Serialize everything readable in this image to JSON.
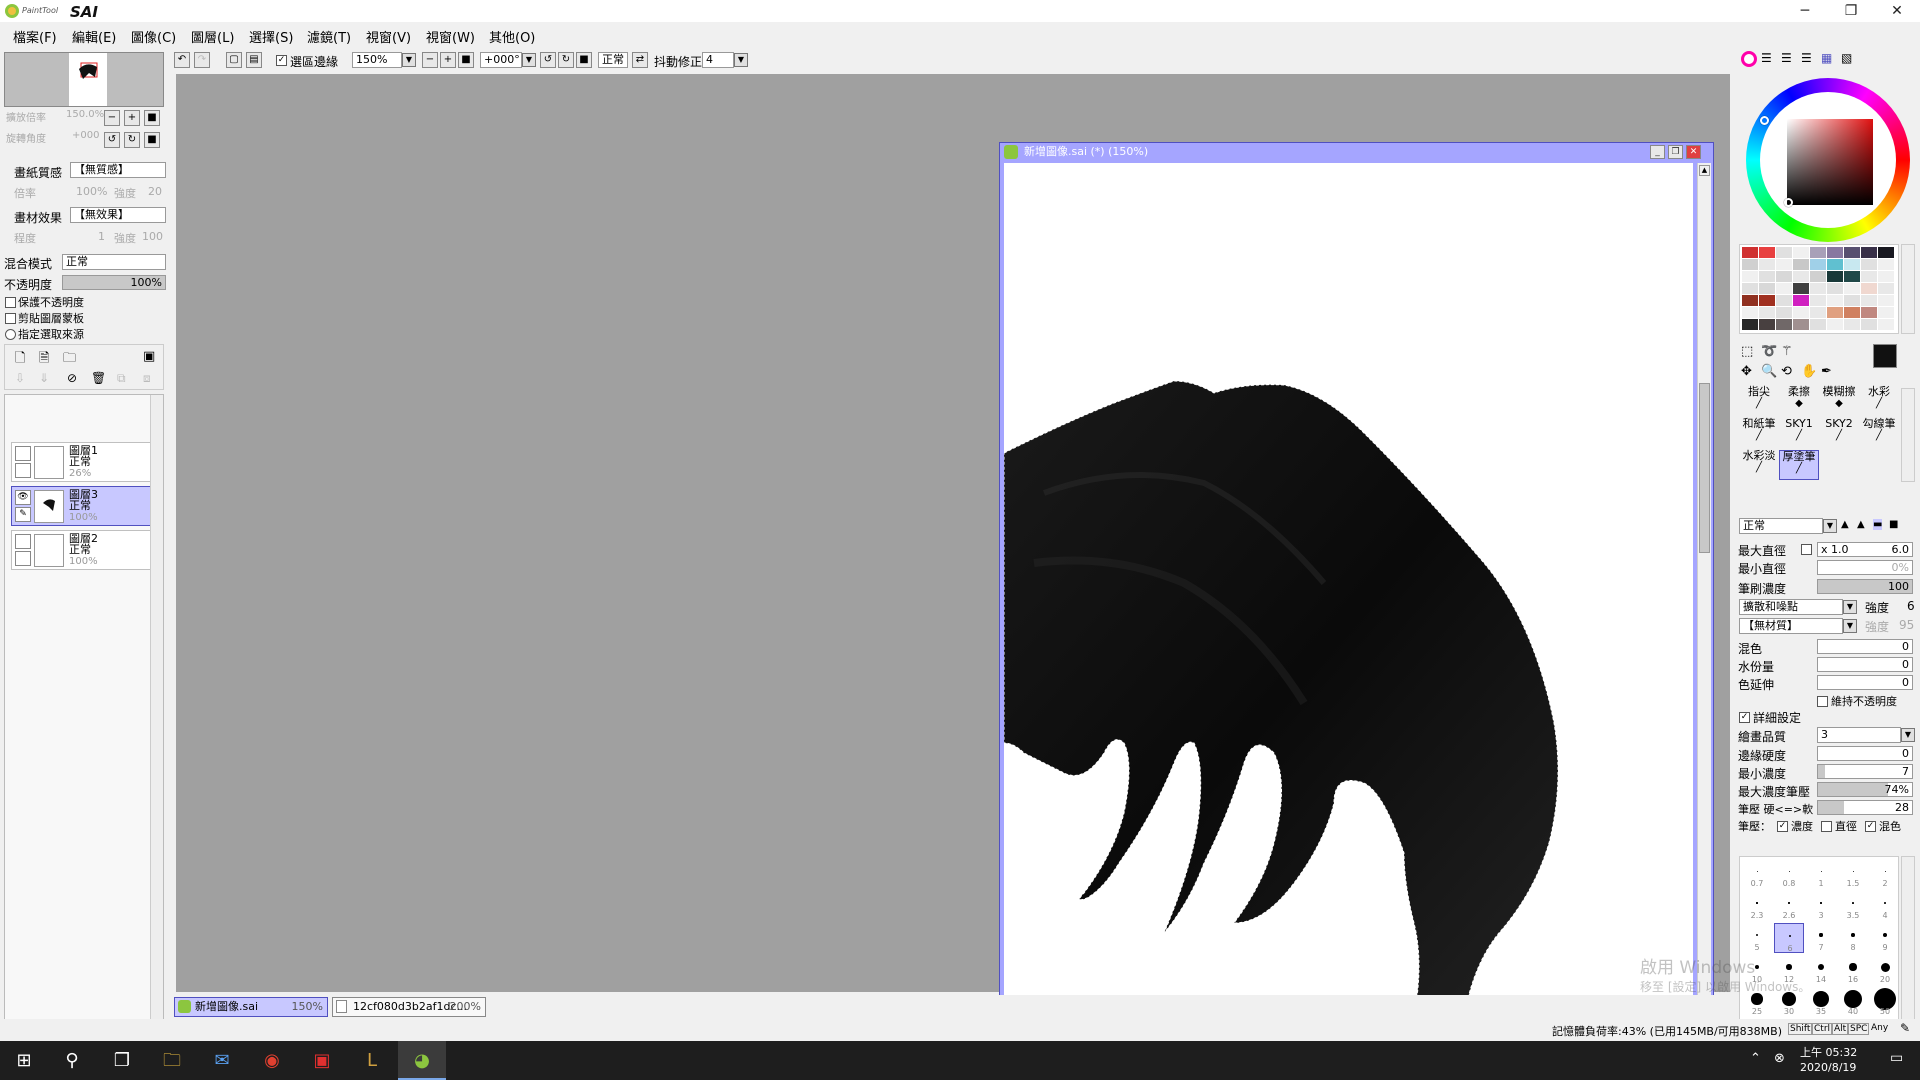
{
  "app": {
    "logo_text": "PaintTool SAI",
    "window_controls": [
      "─",
      "❐",
      "✕"
    ]
  },
  "menu": [
    "檔案(F)",
    "編輯(E)",
    "圖像(C)",
    "圖層(L)",
    "選擇(S)",
    "濾鏡(T)",
    "視窗(V)",
    "視窗(W)",
    "其他(O)"
  ],
  "navigator": {
    "zoom_label": "擴放倍率",
    "zoom_value": "150.0%",
    "rotate_label": "旋轉角度",
    "rotate_value": "+000"
  },
  "paper": {
    "texture_label": "畫紙質感",
    "texture_value": "【無質感】",
    "ratio_label": "倍率",
    "ratio_value": "100%",
    "strength_label": "強度",
    "strength_value": "20",
    "effect_label": "畫材效果",
    "effect_value": "【無效果】",
    "degree_label": "程度",
    "degree_value": "1",
    "effect_strength_label": "強度",
    "effect_strength_value": "100"
  },
  "layer_props": {
    "blend_label": "混合模式",
    "blend_value": "正常",
    "opacity_label": "不透明度",
    "opacity_value": "100%",
    "opacity_fraction": 1.0,
    "preserve_opacity": "保護不透明度",
    "clip_group": "剪貼圖層蒙板",
    "selection_source": "指定選取來源"
  },
  "layers": [
    {
      "name": "圖層1",
      "mode": "正常",
      "opacity": "26%",
      "selected": false,
      "visible": false
    },
    {
      "name": "圖層3",
      "mode": "正常",
      "opacity": "100%",
      "selected": true,
      "visible": true
    },
    {
      "name": "圖層2",
      "mode": "正常",
      "opacity": "100%",
      "selected": false,
      "visible": false
    }
  ],
  "toolbar": {
    "antialias_label": "選區邊緣",
    "zoom_value": "150%",
    "angle_value": "+000°",
    "blend_value": "正常",
    "stabilizer_label": "抖動修正",
    "stabilizer_value": "4"
  },
  "canvas_window": {
    "title": "新增圖像.sai (*) (150%)"
  },
  "doc_tabs": [
    {
      "name": "新增圖像.sai",
      "zoom": "150%",
      "active": true
    },
    {
      "name": "12cf080d3b2af1dc...",
      "zoom": "200%",
      "active": false
    }
  ],
  "palette_colors": [
    "#d03030",
    "#e84040",
    "#e0e0e0",
    "#f0f0f0",
    "#a8a0b8",
    "#8878a0",
    "#585070",
    "#383048",
    "#181820",
    "#d0d0d0",
    "#e8e8e8",
    "#f0f0f0",
    "#c8c8c8",
    "#a0d0e8",
    "#60c0d0",
    "#c8e8f0",
    "#e0e0e0",
    "#f0f0f0",
    "#f0f0f0",
    "#e0e0e0",
    "#d8d8d8",
    "#e8e8e8",
    "#d0d0d0",
    "#183838",
    "#204848",
    "#e8e8e8",
    "#f0f0f0",
    "#e0e0e0",
    "#d8d8d8",
    "#f0f0f0",
    "#404040",
    "#e8e8e8",
    "#e0e0e0",
    "#f0f0f0",
    "#f0d8d0",
    "#e8e8e8",
    "#903020",
    "#a03020",
    "#e0e0e0",
    "#d020c0",
    "#e8e8e8",
    "#f0f0f0",
    "#e0e0e0",
    "#e8e8e8",
    "#f0f0f0",
    "#f0f0f0",
    "#e8e8e8",
    "#e0e0e0",
    "#f0f0f0",
    "#e8e8e8",
    "#e0a080",
    "#d08060",
    "#c08880",
    "#f0f0f0",
    "#282828",
    "#484040",
    "#706868",
    "#a09090",
    "#e0e0e0",
    "#f0f0f0",
    "#e8e8e8",
    "#e0e0e0",
    "#f0f0f0"
  ],
  "brushes": [
    {
      "name": "指尖",
      "selected": false
    },
    {
      "name": "柔擦",
      "selected": false
    },
    {
      "name": "模糊擦",
      "selected": false
    },
    {
      "name": "水彩",
      "selected": false
    },
    {
      "name": "和紙筆",
      "selected": false
    },
    {
      "name": "SKY1",
      "selected": false
    },
    {
      "name": "SKY2",
      "selected": false
    },
    {
      "name": "勾線筆",
      "selected": false
    },
    {
      "name": "水彩淡",
      "selected": false
    },
    {
      "name": "厚塗筆",
      "selected": true
    }
  ],
  "brush_settings": {
    "mode": "正常",
    "max_size_label": "最大直徑",
    "max_size_mult": "x 1.0",
    "max_size_value": "6.0",
    "min_size_label": "最小直徑",
    "min_size_value": "0%",
    "density_label": "筆刷濃度",
    "density_value": "100",
    "density_fraction": 1.0,
    "shape_value": "擴散和噪點",
    "shape_strength_label": "強度",
    "shape_strength_value": "6",
    "texture_value": "【無材質】",
    "texture_strength_label": "強度",
    "texture_strength_value": "95",
    "blend_label": "混色",
    "blend_value": "0",
    "water_label": "水份量",
    "water_value": "0",
    "persist_label": "色延伸",
    "persist_value": "0",
    "keep_opacity_label": "維持不透明度",
    "advanced_label": "詳細設定",
    "quality_label": "繪畫品質",
    "quality_value": "3",
    "edge_label": "邊緣硬度",
    "edge_value": "0",
    "min_density_label": "最小濃度",
    "min_density_value": "7",
    "min_density_fraction": 0.07,
    "max_pressure_label": "最大濃度筆壓",
    "max_pressure_value": "74%",
    "max_pressure_fraction": 0.74,
    "hardsoft_label": "筆壓 硬<=>軟",
    "hardsoft_value": "28",
    "hardsoft_fraction": 0.28,
    "pressure_label": "筆壓：",
    "pressure_density": "濃度",
    "pressure_size": "直徑",
    "pressure_blend": "混色"
  },
  "brush_sizes": [
    "0.7",
    "0.8",
    "1",
    "1.5",
    "2",
    "2.3",
    "2.6",
    "3",
    "3.5",
    "4",
    "5",
    "6",
    "7",
    "8",
    "9",
    "10",
    "12",
    "14",
    "16",
    "20",
    "25",
    "30",
    "35",
    "40",
    "50"
  ],
  "status": {
    "memory": "記憶體負荷率:43% (已用145MB/可用838MB)",
    "keys": [
      "Shift",
      "Ctrl",
      "Alt",
      "SPC",
      "Any"
    ]
  },
  "taskbar": {
    "time": "上午 05:32",
    "date": "2020/8/19"
  },
  "watermark": {
    "line1": "啟用 Windows",
    "line2": "移至 [設定] 以啟用 Windows。"
  }
}
